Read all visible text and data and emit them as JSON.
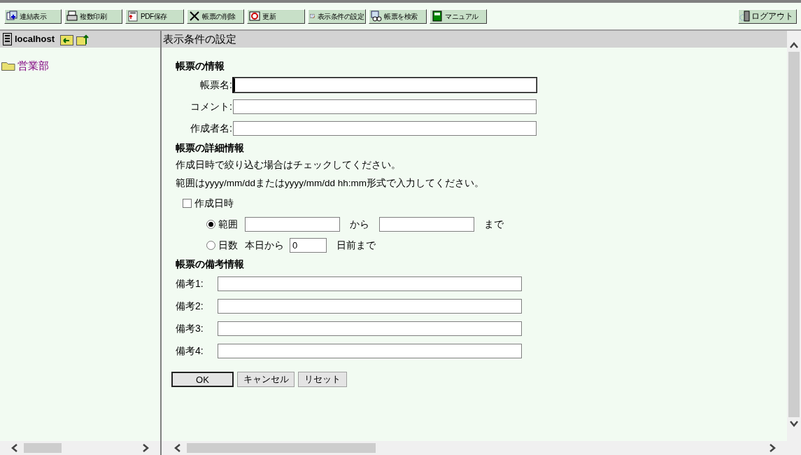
{
  "toolbar": [
    {
      "label": "連結表示"
    },
    {
      "label": "複数印刷"
    },
    {
      "label": "PDF保存"
    },
    {
      "label": "帳票の削除"
    },
    {
      "label": "更新"
    },
    {
      "label": "表示条件の設定"
    },
    {
      "label": "帳票を検索"
    },
    {
      "label": "マニュアル"
    }
  ],
  "logout": {
    "label": "ログアウト"
  },
  "sidebar": {
    "host": "localhost",
    "items": [
      {
        "label": "営業部"
      }
    ]
  },
  "panel": {
    "title": "表示条件の設定"
  },
  "report_info": {
    "heading": "帳票の情報",
    "fields": [
      {
        "label": "帳票名:",
        "focused": true
      },
      {
        "label": "コメント:",
        "focused": false
      },
      {
        "label": "作成者名:",
        "focused": false
      }
    ]
  },
  "details": {
    "heading": "帳票の詳細情報",
    "notes": [
      "作成日時で絞り込む場合はチェックしてください。",
      "範囲はyyyy/mm/ddまたはyyyy/mm/dd hh:mm形式で入力してください。"
    ],
    "date_filter": {
      "label": "作成日時",
      "checked": false
    },
    "options": [
      {
        "kind": "range",
        "label": "範囲",
        "selected": true,
        "between": "から",
        "after": "まで"
      },
      {
        "kind": "days",
        "label": "日数",
        "selected": false,
        "before": "本日から",
        "value": "0",
        "after": "日前まで"
      }
    ]
  },
  "remarks": {
    "heading": "帳票の備考情報",
    "fields": [
      {
        "label": "備考1:"
      },
      {
        "label": "備考2:"
      },
      {
        "label": "備考3:"
      },
      {
        "label": "備考4:"
      }
    ]
  },
  "buttons": [
    {
      "label": "OK",
      "default": true
    },
    {
      "label": "キャンセル",
      "default": false
    },
    {
      "label": "リセット",
      "default": false
    }
  ]
}
